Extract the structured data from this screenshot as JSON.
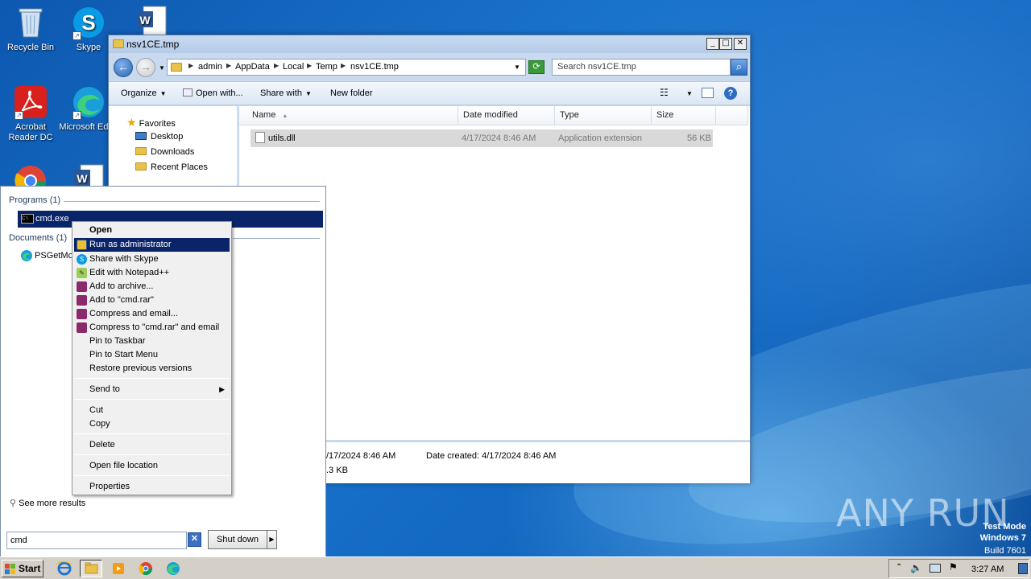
{
  "desktop": {
    "icons": [
      {
        "label": "Recycle Bin"
      },
      {
        "label": "Skype"
      },
      {
        "label": "Acrobat Reader DC"
      },
      {
        "label": "Microsoft Edge"
      }
    ],
    "watermark": {
      "line1": "Test Mode",
      "line2": "Windows 7",
      "line3": "Build 7601"
    },
    "brand": "ANY RUN"
  },
  "explorer": {
    "title": "nsv1CE.tmp",
    "breadcrumb": [
      "admin",
      "AppData",
      "Local",
      "Temp",
      "nsv1CE.tmp"
    ],
    "search_placeholder": "Search nsv1CE.tmp",
    "toolbar": {
      "organize": "Organize",
      "open_with": "Open with...",
      "share_with": "Share with",
      "new_folder": "New folder"
    },
    "nav": {
      "favorites": "Favorites",
      "items": [
        "Desktop",
        "Downloads",
        "Recent Places"
      ]
    },
    "columns": [
      "Name",
      "Date modified",
      "Type",
      "Size"
    ],
    "files": [
      {
        "name": "utils.dll",
        "modified": "4/17/2024 8:46 AM",
        "type": "Application extension",
        "size": "56 KB"
      }
    ],
    "details": {
      "modified_partial": "/17/2024 8:46 AM",
      "created": "Date created: 4/17/2024 8:46 AM",
      "size_partial": ".3 KB"
    }
  },
  "start_menu": {
    "programs_header": "Programs (1)",
    "program_item": "cmd.exe",
    "documents_header": "Documents (1)",
    "document_item": "PSGetMo",
    "see_more": "See more results",
    "search_value": "cmd",
    "shutdown_label": "Shut down"
  },
  "context_menu": {
    "items": [
      "Open",
      "Run as administrator",
      "Share with Skype",
      "Edit with Notepad++",
      "Add to archive...",
      "Add to \"cmd.rar\"",
      "Compress and email...",
      "Compress to \"cmd.rar\" and email",
      "Pin to Taskbar",
      "Pin to Start Menu",
      "Restore previous versions",
      "Send to",
      "Cut",
      "Copy",
      "Delete",
      "Open file location",
      "Properties"
    ]
  },
  "taskbar": {
    "start_label": "Start",
    "clock": "3:27 AM"
  }
}
